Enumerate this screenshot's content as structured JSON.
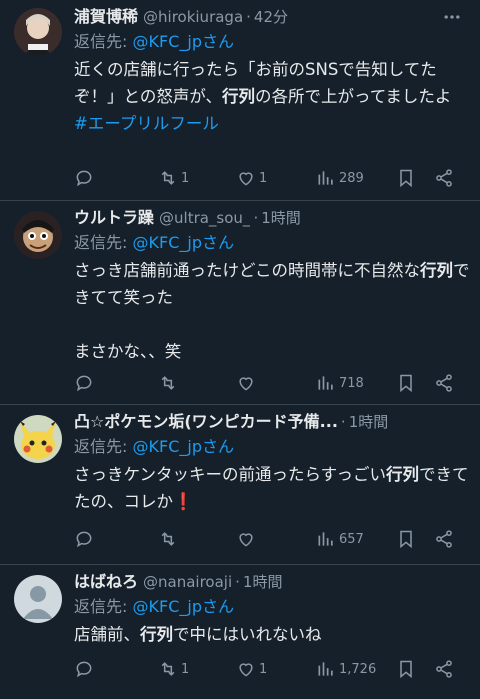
{
  "replying_label": "返信先:",
  "tweets": [
    {
      "name": "浦賀博稀",
      "handle": "@hirokiuraga",
      "time": "42分",
      "mention": "@KFC_jpさん",
      "text_parts": [
        "近くの店舗に行ったら「お前のSNSで告知してたぞ！」との怒声が、",
        "行列",
        "の各所で上がってましたよ"
      ],
      "hashtag": "#エープリルフール",
      "replies": "",
      "retweets": "1",
      "likes": "1",
      "views": "289"
    },
    {
      "name": "ウルトラ躁",
      "handle": "@ultra_sou_",
      "time": "1時間",
      "mention": "@KFC_jpさん",
      "text_parts": [
        "さっき店舗前通ったけどこの時間帯に不自然な",
        "行列",
        "できてて笑った"
      ],
      "text_extra": "まさかな、、笑",
      "replies": "",
      "retweets": "",
      "likes": "",
      "views": "718"
    },
    {
      "name": "凸☆ポケモン垢(ワンピカード予備...",
      "handle": "",
      "time": "1時間",
      "mention": "@KFC_jpさん",
      "text_parts": [
        "さっきケンタッキーの前通ったらすっごい",
        "行列",
        "できてたの、コレか❗️"
      ],
      "replies": "",
      "retweets": "",
      "likes": "",
      "views": "657"
    },
    {
      "name": "はばねろ",
      "handle": "@nanairoaji",
      "time": "1時間",
      "mention": "@KFC_jpさん",
      "text_parts": [
        "店舗前、",
        "行列",
        "で中にはいれないね"
      ],
      "replies": "",
      "retweets": "1",
      "likes": "1",
      "views": "1,726"
    }
  ]
}
